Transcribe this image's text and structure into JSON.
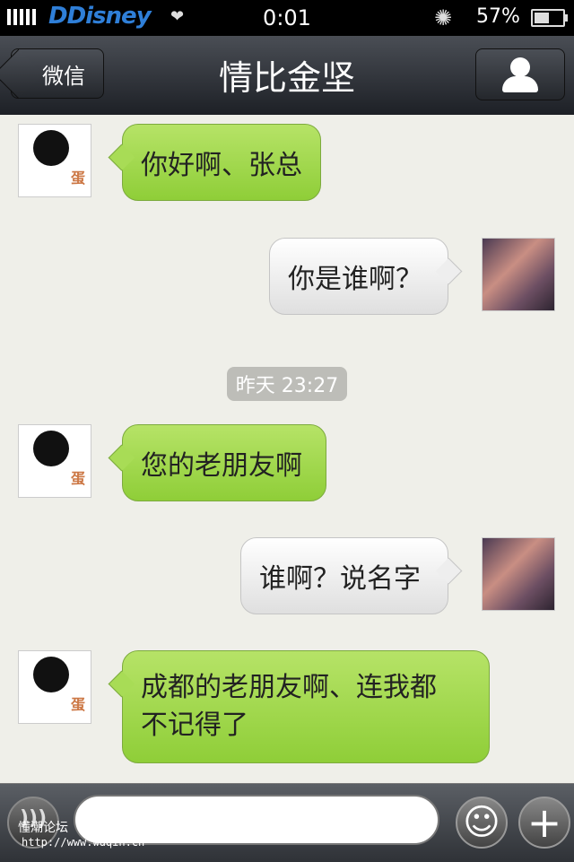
{
  "status_bar": {
    "carrier": "DDisney",
    "time": "0:01",
    "battery": "57%"
  },
  "nav": {
    "back_label": "微信",
    "title": "情比金坚"
  },
  "messages": [
    {
      "side": "left",
      "text": "你好啊、张总"
    },
    {
      "side": "right",
      "text": "你是谁啊？"
    },
    {
      "side": "center",
      "text": "昨天 23:27"
    },
    {
      "side": "left",
      "text": "您的老朋友啊"
    },
    {
      "side": "right",
      "text": "谁啊？说名字"
    },
    {
      "side": "left",
      "text": "成都的老朋友啊、连我都不记得了"
    }
  ],
  "input": {
    "placeholder": ""
  },
  "watermark": {
    "line1": "懂潮论坛",
    "line2": "http://www.wdqin.cn"
  },
  "colors": {
    "incoming_bubble": "#9ed44a",
    "outgoing_bubble": "#f2f2f2",
    "navbar": "#2a2d33"
  }
}
